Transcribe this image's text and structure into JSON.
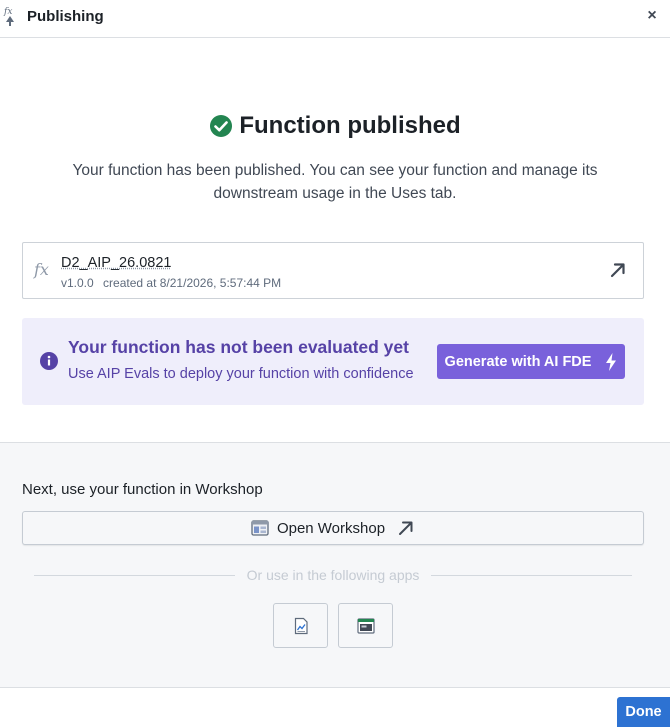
{
  "dialog": {
    "title": "Publishing",
    "logo_icon": "function-icon",
    "close_label": "×"
  },
  "success": {
    "title": "Function published",
    "description": "Your function has been published. You can see your function and manage its downstream usage in the Uses tab.",
    "icon": "check-circle-icon",
    "icon_color": "#238551"
  },
  "function_card": {
    "fx_symbol": "fx",
    "name": "D2_AIP_26.0821",
    "version": "v1.0.0",
    "created": "created at 8/21/2026, 5:57:44 PM",
    "open_icon": "arrow-top-right-icon"
  },
  "evaluation": {
    "heading": "Your function has not been evaluated yet",
    "subtext": "Use AIP Evals to deploy your function with confidence",
    "button_label": "Generate with AI FDE",
    "accent_color": "#5642a6",
    "button_color": "#7961db",
    "icon": "info-sign-icon"
  },
  "next": {
    "label": "Next, use your function in Workshop",
    "workshop_button_label": "Open Workshop",
    "or_text": "Or use in the following apps",
    "apps": [
      {
        "icon": "chart-document-icon"
      },
      {
        "icon": "app-window-icon"
      }
    ]
  },
  "footer": {
    "done_label": "Done",
    "primary_color": "#2d72d2"
  }
}
